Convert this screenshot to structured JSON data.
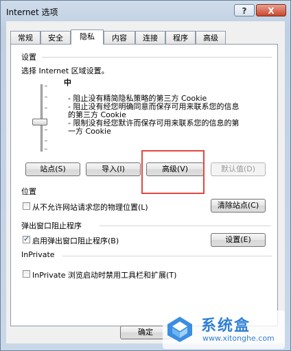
{
  "window": {
    "title": "Internet 选项",
    "help_glyph": "?",
    "close_glyph": "X"
  },
  "tabs": [
    {
      "label": "常规"
    },
    {
      "label": "安全"
    },
    {
      "label": "隐私"
    },
    {
      "label": "内容"
    },
    {
      "label": "连接"
    },
    {
      "label": "程序"
    },
    {
      "label": "高级"
    }
  ],
  "active_tab": "隐私",
  "settings": {
    "header": "设置",
    "instruction": "选择 Internet 区域设置。",
    "level": "中",
    "desc_lines": [
      "- 阻止没有精简隐私策略的第三方 Cookie",
      "- 阻止没有经您明确同意而保存可用来联系您的信息",
      "的第三方 Cookie",
      "- 限制没有经您默许而保存可用来联系您的信息的第",
      "一方 Cookie"
    ],
    "buttons": {
      "sites": "站点(S)",
      "import": "导入(I)",
      "advanced": "高级(V)",
      "default": "默认值(D)"
    }
  },
  "location": {
    "header": "位置",
    "checkbox_label": "从不允许网站请求您的物理位置(L)",
    "checked": false,
    "clear_button": "清除站点(C)"
  },
  "popup": {
    "header": "弹出窗口阻止程序",
    "checkbox_label": "启用弹出窗口阻止程序(B)",
    "checked": true,
    "settings_button": "设置(E)"
  },
  "inprivate": {
    "header": "InPrivate",
    "checkbox_label": "InPrivate 浏览启动时禁用工具栏和扩展(T)",
    "checked": false
  },
  "footer": {
    "ok_button": "确定"
  },
  "watermark": {
    "name": "系统盒",
    "url": "www.xitonghe.com"
  },
  "colors": {
    "highlight": "#e0463f",
    "watermark": "#2f7fd6"
  }
}
